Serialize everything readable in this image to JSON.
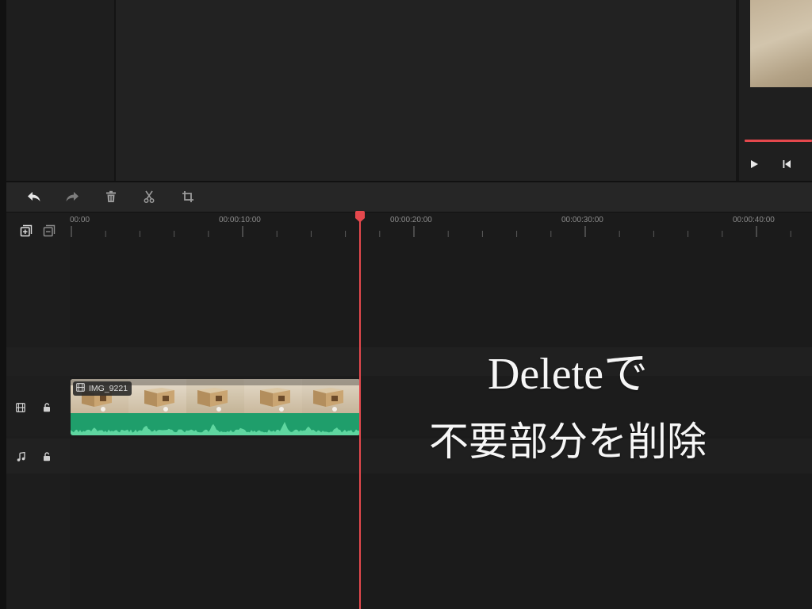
{
  "app": {
    "accent_color": "#e5484d",
    "clip_audio_color": "#1f9e6b",
    "waveform_color": "#5fd6a0"
  },
  "preview": {
    "controls": [
      {
        "icon": "play-icon"
      },
      {
        "icon": "skip-to-start-icon"
      }
    ]
  },
  "toolbar": {
    "items": [
      {
        "icon": "undo-icon",
        "enabled": true
      },
      {
        "icon": "redo-icon",
        "enabled": false
      },
      {
        "icon": "trash-icon",
        "enabled": true
      },
      {
        "icon": "scissors-icon",
        "enabled": true
      },
      {
        "icon": "crop-icon",
        "enabled": true
      }
    ]
  },
  "timeline": {
    "track_controls": [
      {
        "icon": "add-track-icon"
      },
      {
        "icon": "remove-track-icon"
      }
    ],
    "ruler_labels": [
      "00:00",
      "00:00:10:00",
      "00:00:20:00",
      "00:00:30:00",
      "00:00:40:00"
    ],
    "playhead_seconds": 16.85,
    "tracks": [
      {
        "type": "video",
        "icon": "film-icon",
        "lock_icon": "lock-icon"
      },
      {
        "type": "audio",
        "icon": "music-note-icon",
        "lock_icon": "lock-icon"
      }
    ],
    "clip": {
      "name": "IMG_9221",
      "badge_icon": "film-icon",
      "start_seconds": 0,
      "end_seconds": 16.8,
      "thumbnail_count": 5
    }
  },
  "caption": {
    "line1_main": "Delete",
    "line1_suffix": "で",
    "line2": "不要部分を削除"
  }
}
